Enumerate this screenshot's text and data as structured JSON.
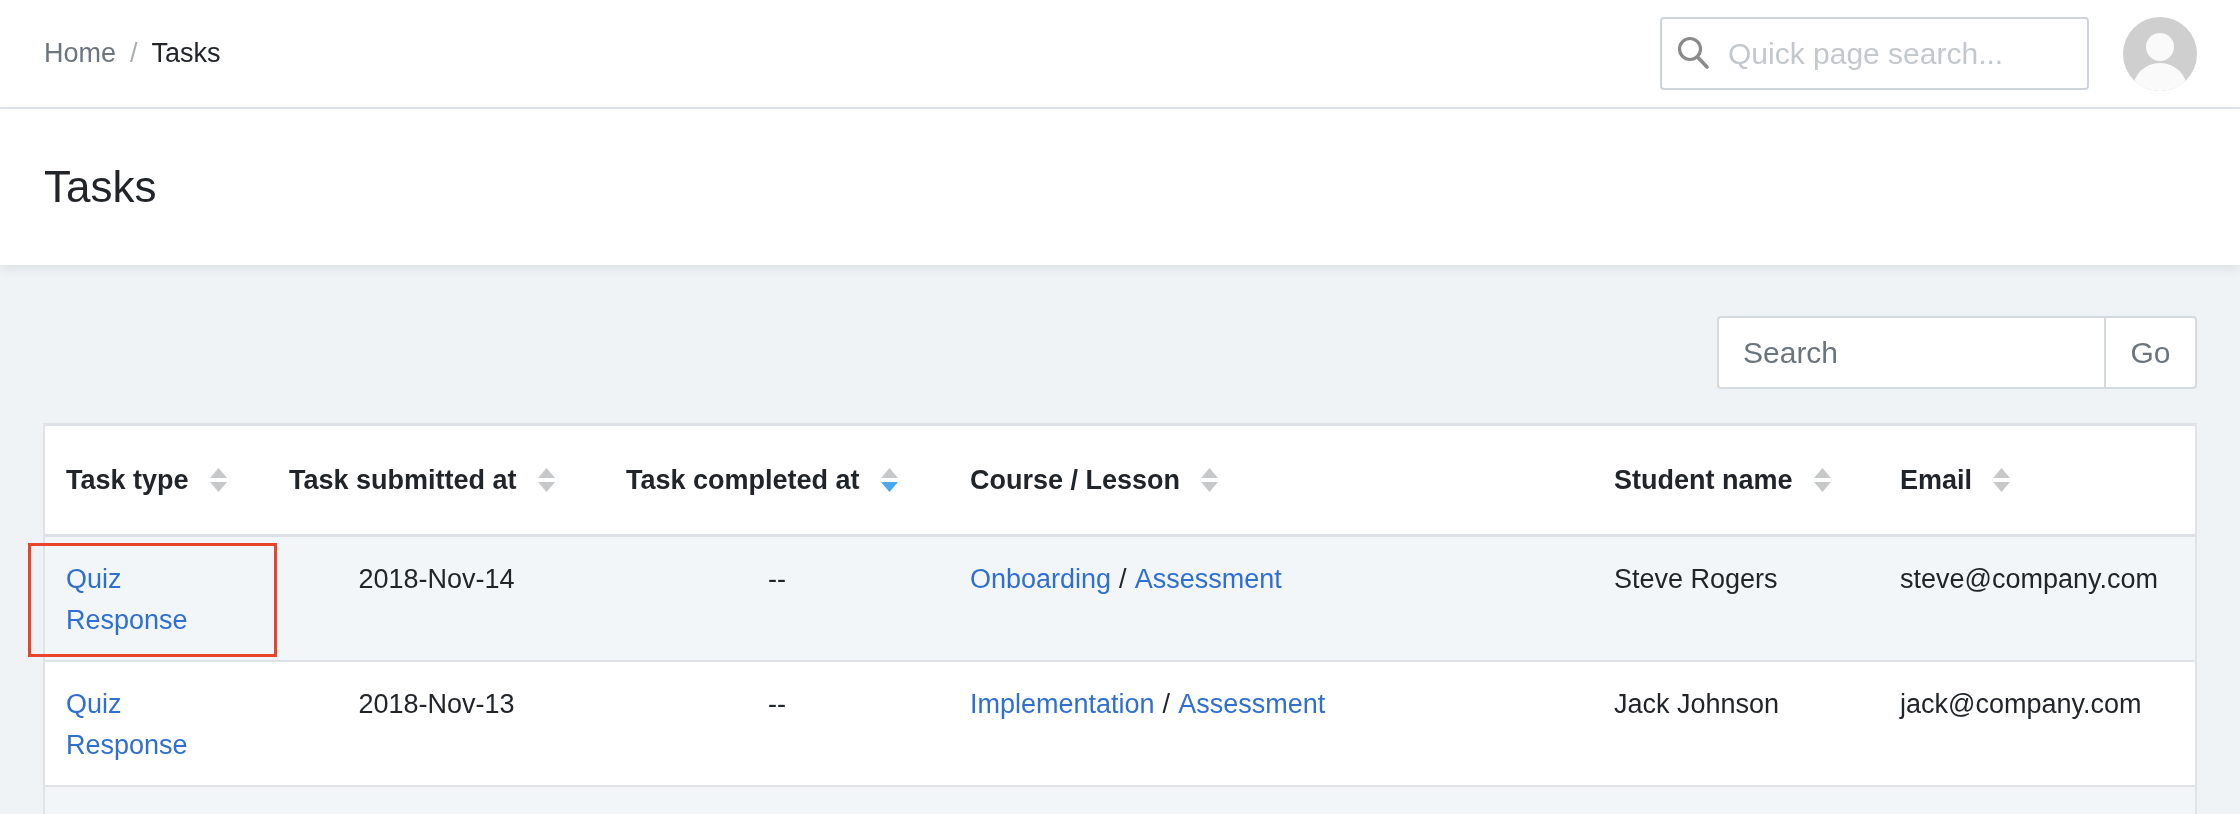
{
  "breadcrumb": {
    "items": [
      {
        "label": "Home",
        "current": false
      },
      {
        "label": "Tasks",
        "current": true
      }
    ],
    "separator": "/"
  },
  "quick_search": {
    "placeholder": "Quick page search..."
  },
  "page_title": "Tasks",
  "table_search": {
    "placeholder": "Search",
    "button": "Go"
  },
  "table": {
    "columns": [
      {
        "label": "Task type",
        "sorted": false
      },
      {
        "label": "Task submitted at",
        "sorted": false
      },
      {
        "label": "Task completed at",
        "sorted": true,
        "descending": true
      },
      {
        "label": "Course / Lesson",
        "sorted": false
      },
      {
        "label": "Student name",
        "sorted": false
      },
      {
        "label": "Email",
        "sorted": false
      }
    ],
    "rows": [
      {
        "highlighted": true,
        "task_type": "Quiz Response",
        "submitted_at": "2018-Nov-14",
        "completed_at": "--",
        "course": "Onboarding",
        "separator": "/",
        "lesson": "Assessment",
        "student_name": "Steve Rogers",
        "email": "steve@company.com"
      },
      {
        "highlighted": false,
        "task_type": "Quiz Response",
        "submitted_at": "2018-Nov-13",
        "completed_at": "--",
        "course": "Implementation",
        "separator": "/",
        "lesson": "Assessment",
        "student_name": "Jack Johnson",
        "email": "jack@company.com"
      }
    ]
  }
}
